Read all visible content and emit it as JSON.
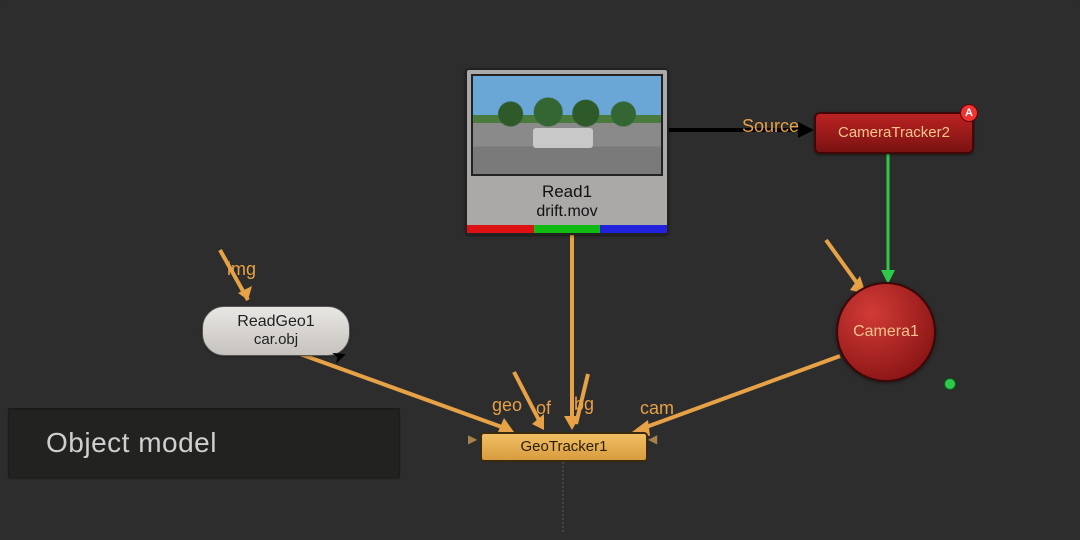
{
  "caption": "Object model",
  "nodes": {
    "read": {
      "name": "Read1",
      "file": "drift.mov"
    },
    "readgeo": {
      "name": "ReadGeo1",
      "file": "car.obj"
    },
    "geotracker": {
      "name": "GeoTracker1"
    },
    "cameratracker": {
      "name": "CameraTracker2",
      "badge": "A"
    },
    "camera": {
      "name": "Camera1"
    }
  },
  "labels": {
    "img": "img",
    "source": "Source",
    "geo": "geo",
    "of": "of",
    "bg": "bg",
    "cam": "cam"
  },
  "dots": {
    "green": "green"
  }
}
